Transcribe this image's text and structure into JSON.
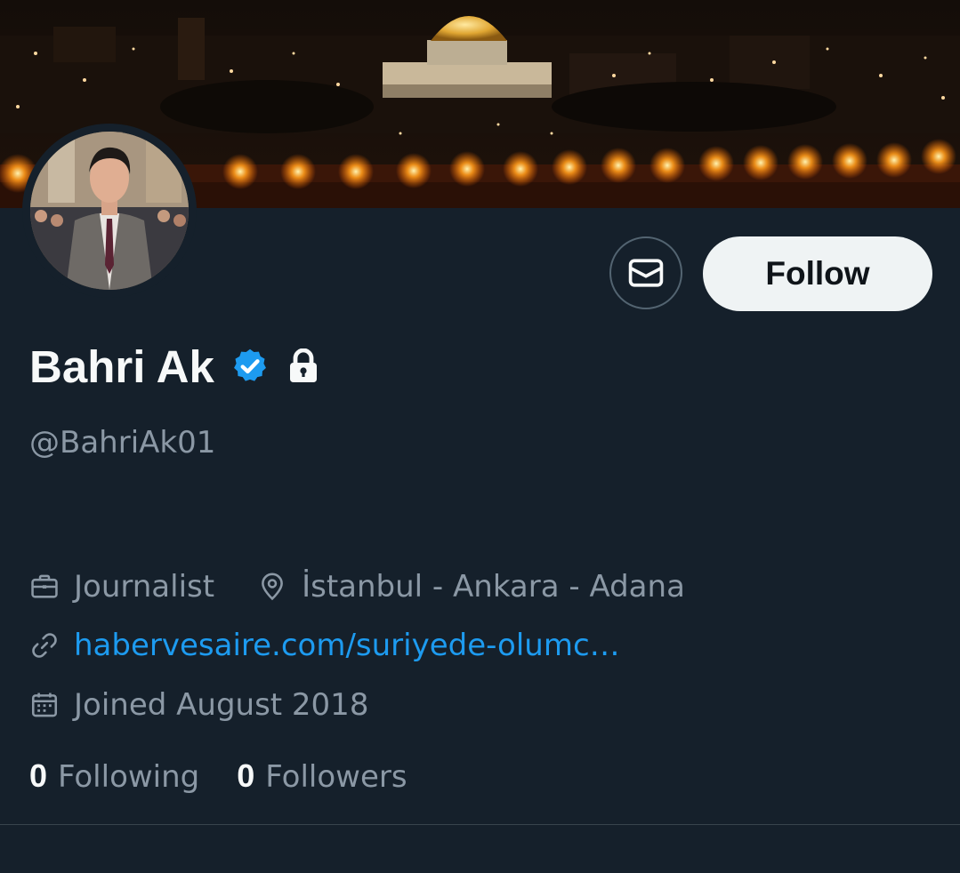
{
  "profile": {
    "display_name": "Bahri Ak",
    "handle": "@BahriAk01",
    "verified_icon": "verified-badge-icon",
    "protected_icon": "lock-icon",
    "profession": "Journalist",
    "location": "İstanbul - Ankara - Adana",
    "website": "habervesaire.com/suriyede-olumc…",
    "joined": "Joined August 2018"
  },
  "actions": {
    "message_icon": "envelope-icon",
    "follow_label": "Follow"
  },
  "stats": {
    "following_count": "0",
    "following_label": "Following",
    "followers_count": "0",
    "followers_label": "Followers"
  },
  "colors": {
    "background": "#15202b",
    "accent": "#1d9bf0",
    "secondary_text": "#8b98a5",
    "follow_button_bg": "#eff3f4"
  }
}
